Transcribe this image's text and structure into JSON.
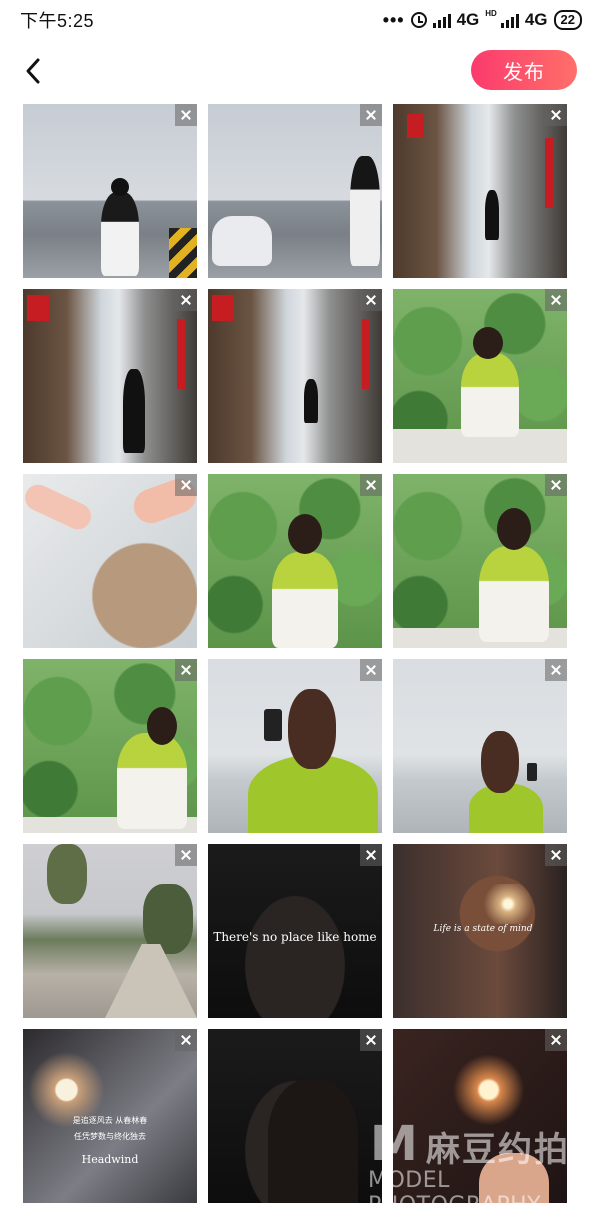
{
  "status_bar": {
    "time": "下午5:25",
    "dots": "•••",
    "network_1": "4G",
    "hd_label": "HD",
    "network_2": "4G",
    "battery": "22"
  },
  "header": {
    "publish_label": "发布"
  },
  "grid": {
    "photos": [
      {
        "id": 1,
        "overlay": ""
      },
      {
        "id": 2,
        "overlay": ""
      },
      {
        "id": 3,
        "overlay": ""
      },
      {
        "id": 4,
        "overlay": ""
      },
      {
        "id": 5,
        "overlay": ""
      },
      {
        "id": 6,
        "overlay": ""
      },
      {
        "id": 7,
        "overlay": ""
      },
      {
        "id": 8,
        "overlay": ""
      },
      {
        "id": 9,
        "overlay": ""
      },
      {
        "id": 10,
        "overlay": ""
      },
      {
        "id": 11,
        "overlay": ""
      },
      {
        "id": 12,
        "overlay": ""
      },
      {
        "id": 13,
        "overlay": ""
      },
      {
        "id": 14,
        "overlay": "There's no place like home"
      },
      {
        "id": 15,
        "overlay": "Life is a state of mind"
      },
      {
        "id": 16,
        "overlay_cn_1": "是追逐风去 从春林春",
        "overlay_cn_2": "任凭梦数与终化独去",
        "overlay": "Headwind"
      },
      {
        "id": 17,
        "overlay": ""
      },
      {
        "id": 18,
        "overlay": ""
      }
    ]
  },
  "watermark": {
    "logo": "M",
    "cn": "麻豆约拍",
    "en": "MODEL PHOTOGRAPHY"
  },
  "colors": {
    "publish_gradient_start": "#fb3a6c",
    "publish_gradient_end": "#ff6f6a"
  },
  "icons": [
    "back-arrow-icon",
    "alarm-icon",
    "signal-icon",
    "battery-icon",
    "close-icon"
  ]
}
